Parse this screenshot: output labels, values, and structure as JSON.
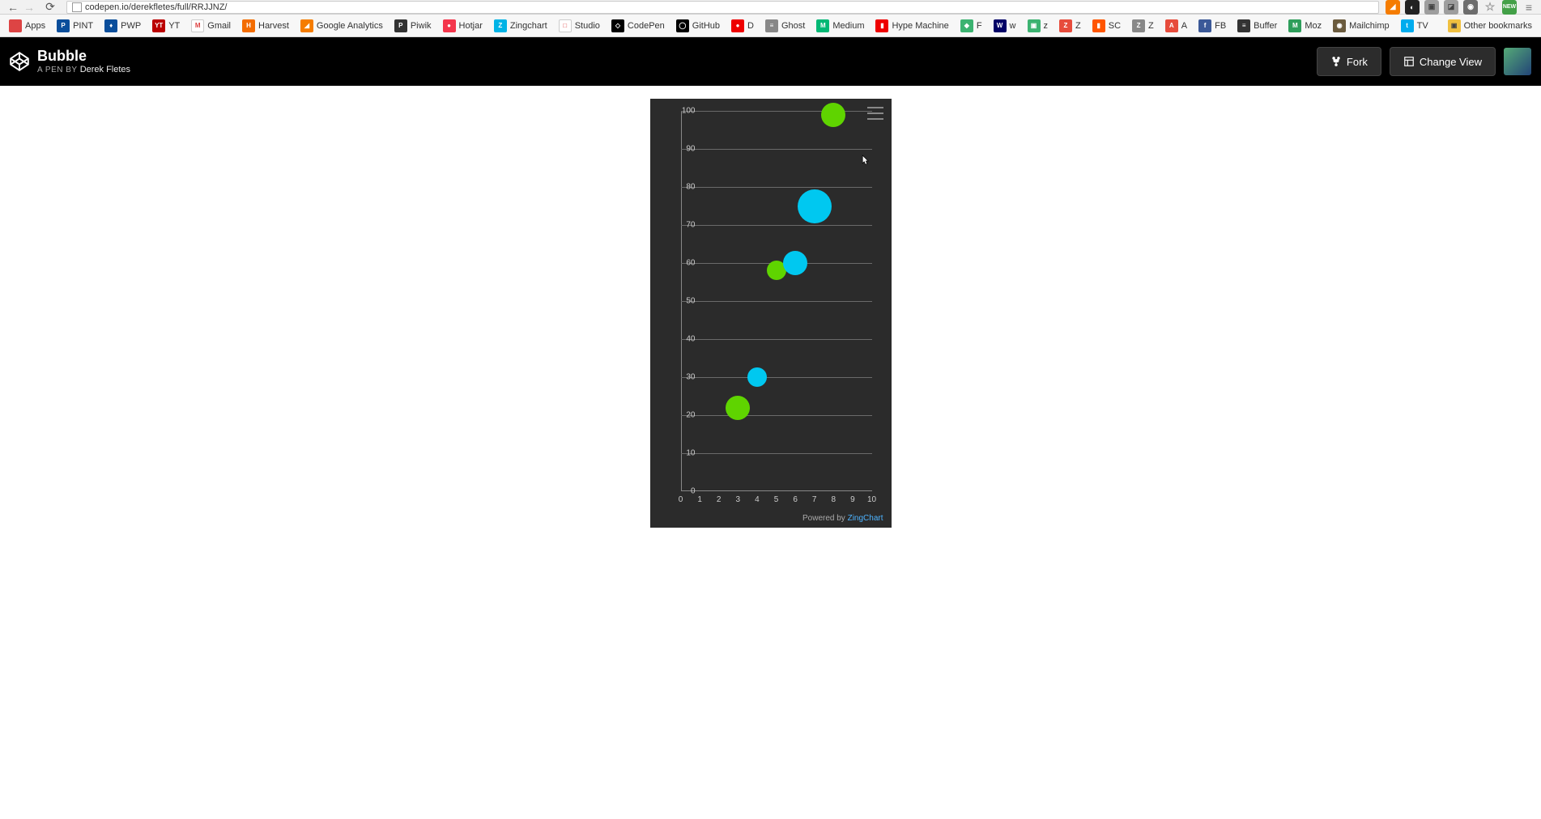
{
  "browser": {
    "url": "codepen.io/derekfletes/full/RRJJNZ/",
    "other_bookmarks": "Other bookmarks"
  },
  "bookmarks": [
    {
      "label": "Apps",
      "bg": "#d44",
      "txt": ""
    },
    {
      "label": "PINT",
      "bg": "#0a4e9b",
      "txt": "P"
    },
    {
      "label": "PWP",
      "bg": "#0a4e9b",
      "txt": "♦"
    },
    {
      "label": "YT",
      "bg": "#b00",
      "txt": "YT"
    },
    {
      "label": "Gmail",
      "bg": "#fff",
      "txt": "M"
    },
    {
      "label": "Harvest",
      "bg": "#f36c00",
      "txt": "H"
    },
    {
      "label": "Google Analytics",
      "bg": "#f57c00",
      "txt": "◢"
    },
    {
      "label": "Piwik",
      "bg": "#333",
      "txt": "P"
    },
    {
      "label": "Hotjar",
      "bg": "#f4364c",
      "txt": "●"
    },
    {
      "label": "Zingchart",
      "bg": "#00b3e6",
      "txt": "Z"
    },
    {
      "label": "Studio",
      "bg": "#fff",
      "txt": "□"
    },
    {
      "label": "CodePen",
      "bg": "#000",
      "txt": "◇"
    },
    {
      "label": "GitHub",
      "bg": "#000",
      "txt": "◯"
    },
    {
      "label": "D",
      "bg": "#e00",
      "txt": "●"
    },
    {
      "label": "Ghost",
      "bg": "#888",
      "txt": "≡"
    },
    {
      "label": "Medium",
      "bg": "#02b875",
      "txt": "M"
    },
    {
      "label": "Hype Machine",
      "bg": "#e00",
      "txt": "▮"
    },
    {
      "label": "F",
      "bg": "#3cb371",
      "txt": "◆"
    },
    {
      "label": "w",
      "bg": "#006",
      "txt": "W"
    },
    {
      "label": "z",
      "bg": "#3cb371",
      "txt": "▣"
    },
    {
      "label": "Z",
      "bg": "#e74c3c",
      "txt": "Z"
    },
    {
      "label": "SC",
      "bg": "#f50",
      "txt": "▮"
    },
    {
      "label": "Z",
      "bg": "#888",
      "txt": "Z"
    },
    {
      "label": "A",
      "bg": "#e74c3c",
      "txt": "A"
    },
    {
      "label": "FB",
      "bg": "#3b5998",
      "txt": "f"
    },
    {
      "label": "Buffer",
      "bg": "#333",
      "txt": "≡"
    },
    {
      "label": "Moz",
      "bg": "#2e9e5b",
      "txt": "M"
    },
    {
      "label": "Mailchimp",
      "bg": "#6b5b3e",
      "txt": "◉"
    },
    {
      "label": "TV",
      "bg": "#00acee",
      "txt": "t"
    }
  ],
  "codepen": {
    "title": "Bubble",
    "pen_by": "A PEN BY",
    "author": "Derek Fletes",
    "fork": "Fork",
    "change_view": "Change View"
  },
  "chart_data": {
    "type": "bubble",
    "xlim": [
      0,
      10
    ],
    "ylim": [
      0,
      100
    ],
    "x_ticks": [
      0,
      1,
      2,
      3,
      4,
      5,
      6,
      7,
      8,
      9,
      10
    ],
    "y_ticks": [
      0,
      10,
      20,
      30,
      40,
      50,
      60,
      70,
      80,
      90,
      100
    ],
    "series": [
      {
        "name": "green",
        "color": "#5fd400",
        "points": [
          {
            "x": 3,
            "y": 22,
            "size": 30
          },
          {
            "x": 5,
            "y": 58,
            "size": 24
          },
          {
            "x": 8,
            "y": 99,
            "size": 30
          }
        ]
      },
      {
        "name": "cyan",
        "color": "#00c8f0",
        "points": [
          {
            "x": 4,
            "y": 30,
            "size": 24
          },
          {
            "x": 6,
            "y": 60,
            "size": 30
          },
          {
            "x": 7,
            "y": 75,
            "size": 42
          }
        ]
      }
    ],
    "attribution_prefix": "Powered by ",
    "attribution_link": "ZingChart"
  }
}
